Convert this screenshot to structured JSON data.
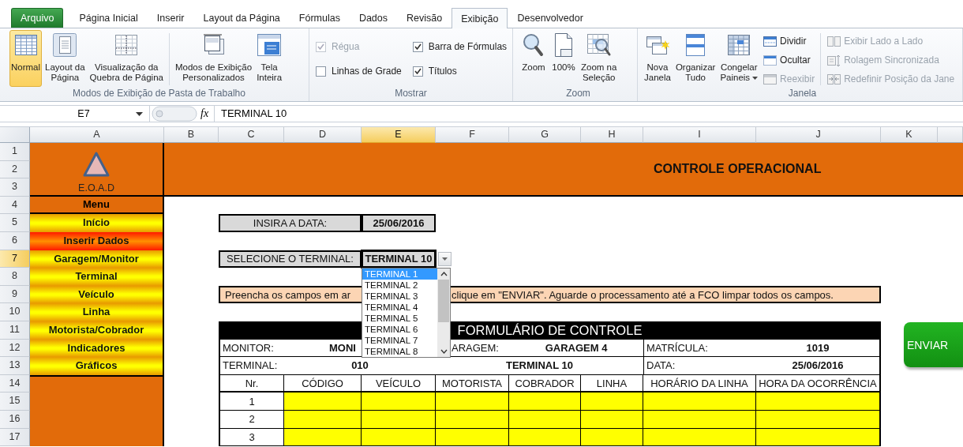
{
  "ribbon": {
    "tabs": [
      {
        "label": "Arquivo",
        "kind": "file",
        "selected": false
      },
      {
        "label": "Página Inicial",
        "kind": "tab",
        "selected": false
      },
      {
        "label": "Inserir",
        "kind": "tab",
        "selected": false
      },
      {
        "label": "Layout da Página",
        "kind": "tab",
        "selected": false
      },
      {
        "label": "Fórmulas",
        "kind": "tab",
        "selected": false
      },
      {
        "label": "Dados",
        "kind": "tab",
        "selected": false
      },
      {
        "label": "Revisão",
        "kind": "tab",
        "selected": false
      },
      {
        "label": "Exibição",
        "kind": "tab",
        "selected": true
      },
      {
        "label": "Desenvolvedor",
        "kind": "tab",
        "selected": false
      }
    ],
    "groups": [
      {
        "label": "Modos de Exibição de Pasta de Trabalho",
        "items": [
          {
            "kind": "large",
            "label": "Normal",
            "selected": true
          },
          {
            "kind": "large",
            "label": "Layout da\nPágina",
            "selected": false
          },
          {
            "kind": "large",
            "label": "Visualização da\nQuebra de Página",
            "selected": false
          },
          {
            "kind": "separator"
          },
          {
            "kind": "large",
            "label": "Modos de Exibição\nPersonalizados",
            "selected": false
          },
          {
            "kind": "large",
            "label": "Tela\nInteira",
            "selected": false
          }
        ]
      },
      {
        "label": "Mostrar",
        "items": [
          {
            "kind": "check",
            "label": "Régua",
            "checked": true,
            "disabled": true
          },
          {
            "kind": "check",
            "label": "Linhas de Grade",
            "checked": false,
            "disabled": false
          },
          {
            "kind": "check",
            "label": "Barra de Fórmulas",
            "checked": true,
            "disabled": false
          },
          {
            "kind": "check",
            "label": "Títulos",
            "checked": true,
            "disabled": false
          }
        ]
      },
      {
        "label": "Zoom",
        "items": [
          {
            "kind": "large",
            "label": "Zoom",
            "selected": false
          },
          {
            "kind": "large",
            "label": "100%",
            "selected": false
          },
          {
            "kind": "large",
            "label": "Zoom na\nSeleção",
            "selected": false
          }
        ]
      },
      {
        "label": "Janela",
        "items": [
          {
            "kind": "large",
            "label": "Nova\nJanela",
            "selected": false
          },
          {
            "kind": "large",
            "label": "Organizar\nTudo",
            "selected": false
          },
          {
            "kind": "large",
            "label": "Congelar\nPaineis",
            "selected": false,
            "dropdown": true
          },
          {
            "kind": "small",
            "label": "Dividir",
            "disabled": false
          },
          {
            "kind": "small",
            "label": "Ocultar",
            "disabled": false
          },
          {
            "kind": "small",
            "label": "Reexibir",
            "disabled": true
          },
          {
            "kind": "separator"
          },
          {
            "kind": "small",
            "label": "Exibir Lado a Lado",
            "disabled": true
          },
          {
            "kind": "small",
            "label": "Rolagem Sincronizada",
            "disabled": true
          },
          {
            "kind": "small",
            "label": "Redefinir Posição da Jane",
            "disabled": true
          }
        ]
      }
    ]
  },
  "formula_bar": {
    "cell": "E7",
    "function_label": "fx",
    "value": "TERMINAL 10"
  },
  "columns": [
    {
      "label": "A",
      "selected": false
    },
    {
      "label": "B",
      "selected": false
    },
    {
      "label": "C",
      "selected": false
    },
    {
      "label": "D",
      "selected": false
    },
    {
      "label": "E",
      "selected": true
    },
    {
      "label": "F",
      "selected": false
    },
    {
      "label": "G",
      "selected": false
    },
    {
      "label": "H",
      "selected": false
    },
    {
      "label": "I",
      "selected": false
    },
    {
      "label": "J",
      "selected": false
    },
    {
      "label": "K",
      "selected": false
    }
  ],
  "rows": [
    {
      "label": "1",
      "selected": false
    },
    {
      "label": "2",
      "selected": false
    },
    {
      "label": "3",
      "selected": false
    },
    {
      "label": "4",
      "selected": false
    },
    {
      "label": "5",
      "selected": false
    },
    {
      "label": "6",
      "selected": false
    },
    {
      "label": "7",
      "selected": true
    },
    {
      "label": "8",
      "selected": false
    },
    {
      "label": "9",
      "selected": false
    },
    {
      "label": "10",
      "selected": false
    },
    {
      "label": "11",
      "selected": false
    },
    {
      "label": "12",
      "selected": false
    },
    {
      "label": "13",
      "selected": false
    },
    {
      "label": "14",
      "selected": false
    },
    {
      "label": "15",
      "selected": false
    },
    {
      "label": "16",
      "selected": false
    },
    {
      "label": "17",
      "selected": false
    }
  ],
  "sheet": {
    "logo": {
      "text": "E.O.A.D"
    },
    "banner": {
      "title": "CONTROLE OPERACIONAL"
    },
    "menu": {
      "title": "Menu",
      "items": [
        {
          "label": "Início",
          "selected": false
        },
        {
          "label": "Inserir Dados",
          "selected": true
        },
        {
          "label": "Garagem/Monitor",
          "selected": false
        },
        {
          "label": "Terminal",
          "selected": false
        },
        {
          "label": "Veículo",
          "selected": false
        },
        {
          "label": "Linha",
          "selected": false
        },
        {
          "label": "Motorista/Cobrador",
          "selected": false
        },
        {
          "label": "Indicadores",
          "selected": false
        },
        {
          "label": "Gráficos",
          "selected": false
        }
      ]
    },
    "date_prompt": {
      "label": "INSIRA A DATA:",
      "value": "25/06/2016"
    },
    "terminal_select": {
      "label": "SELECIONE O TERMINAL:",
      "value": "TERMINAL 10",
      "expanded": true,
      "options": [
        {
          "label": "TERMINAL 1",
          "selected": true
        },
        {
          "label": "TERMINAL 2",
          "selected": false
        },
        {
          "label": "TERMINAL 3",
          "selected": false
        },
        {
          "label": "TERMINAL 4",
          "selected": false
        },
        {
          "label": "TERMINAL 5",
          "selected": false
        },
        {
          "label": "TERMINAL 6",
          "selected": false
        },
        {
          "label": "TERMINAL 7",
          "selected": false
        },
        {
          "label": "TERMINAL 8",
          "selected": false
        }
      ]
    },
    "instruction": [
      "Preencha os campos em ar",
      "clique em \"ENVIAR\". Aguarde o processamento até a FCO limpar todos os campos."
    ],
    "form": {
      "title": "FORMULÁRIO DE CONTROLE",
      "info_rows": [
        [
          {
            "text": "MONITOR:",
            "kind": "label"
          },
          {
            "text": "MONI",
            "kind": "value"
          },
          {
            "text": "ARAGEM:",
            "kind": "label"
          },
          {
            "text": "GARAGEM 4",
            "kind": "value"
          },
          {
            "text": "MATRÍCULA:",
            "kind": "label"
          },
          {
            "text": "1019",
            "kind": "value"
          }
        ],
        [
          {
            "text": "TERMINAL:",
            "kind": "label"
          },
          {
            "text": "010",
            "kind": "value"
          },
          {
            "text": "TERMINAL 10",
            "kind": "value"
          },
          {
            "text": "DATA:",
            "kind": "label"
          },
          {
            "text": "25/06/2016",
            "kind": "value"
          }
        ]
      ],
      "columns": [
        "Nr.",
        "CÓDIGO",
        "VEÍCULO",
        "MOTORISTA",
        "COBRADOR",
        "LINHA",
        "HORÁRIO DA LINHA",
        "HORA DA OCORRÊNCIA"
      ],
      "entries": [
        {
          "number": "1"
        },
        {
          "number": "2"
        },
        {
          "number": "3"
        }
      ]
    },
    "send_button": {
      "label": "ENVIAR"
    }
  }
}
